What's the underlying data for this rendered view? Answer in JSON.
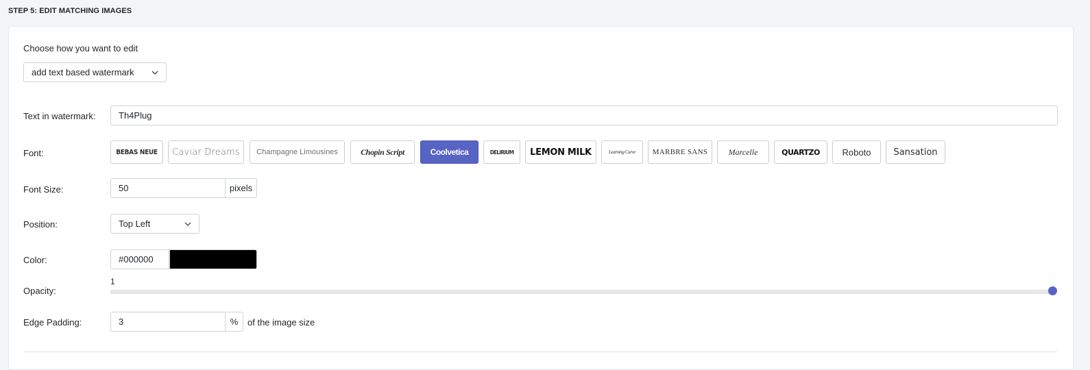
{
  "step_title": "STEP 5: EDIT MATCHING IMAGES",
  "edit_mode": {
    "label": "Choose how you want to edit",
    "selected": "add text based watermark"
  },
  "watermark_text": {
    "label": "Text in watermark:",
    "value": "Th4Plug"
  },
  "font": {
    "label": "Font:",
    "selected": "Coolvetica",
    "options": [
      "BEBAS NEUE",
      "Caviar Dreams",
      "Champagne Limousines",
      "Chopin Script",
      "Coolvetica",
      "DELIRIUM",
      "LEMON MILK",
      "Learning Curve",
      "MARBRE SANS",
      "Marcelle",
      "QUARTZO",
      "Roboto",
      "Sansation"
    ]
  },
  "font_size": {
    "label": "Font Size:",
    "value": "50",
    "unit": "pixels"
  },
  "position": {
    "label": "Position:",
    "selected": "Top Left"
  },
  "color": {
    "label": "Color:",
    "value": "#000000",
    "swatch": "#000000"
  },
  "opacity": {
    "label": "Opacity:",
    "value": "1",
    "fraction": 1.0
  },
  "edge_padding": {
    "label": "Edge Padding:",
    "value": "3",
    "unit": "%",
    "suffix": "of the image size"
  },
  "colors": {
    "accent": "#5864c4",
    "border": "#cfd3d8"
  },
  "icons": {
    "dropdown": "chevron-down-icon"
  }
}
